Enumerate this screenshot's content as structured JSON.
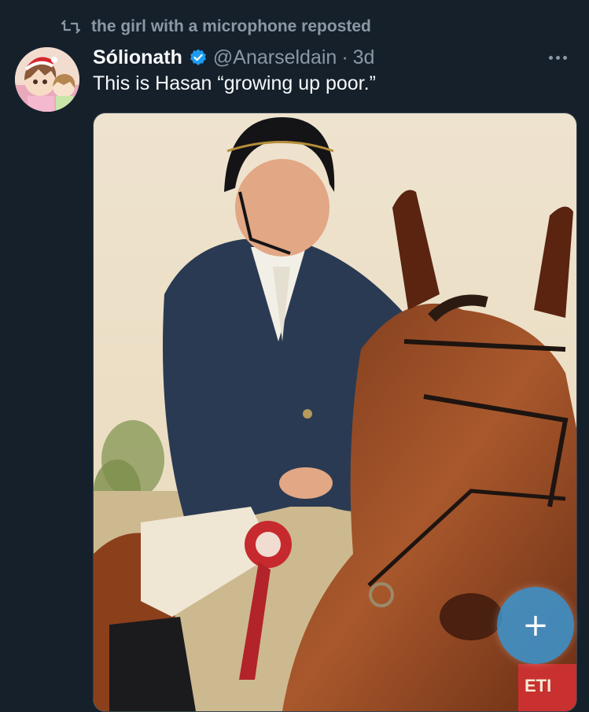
{
  "repost": {
    "icon": "repost-icon",
    "text": "the girl with a microphone reposted"
  },
  "tweet": {
    "avatar_icon": "avatar-anime-girls-santa-hat",
    "display_name": "Sólionath",
    "verified_icon": "verified-badge-icon",
    "handle": "@Anarseldain",
    "separator": "·",
    "time": "3d",
    "more_icon": "more-options-icon",
    "text": "This is Hasan “growing up poor.”",
    "media": {
      "type": "photo",
      "description_icon": "horse-rider-photo"
    }
  },
  "fab": {
    "icon": "compose-plus-icon",
    "glyph": "+"
  },
  "colors": {
    "background": "#15202b",
    "secondary_text": "#8b98a5",
    "verified": "#1d9bf0",
    "fab": "#3b96d2"
  }
}
